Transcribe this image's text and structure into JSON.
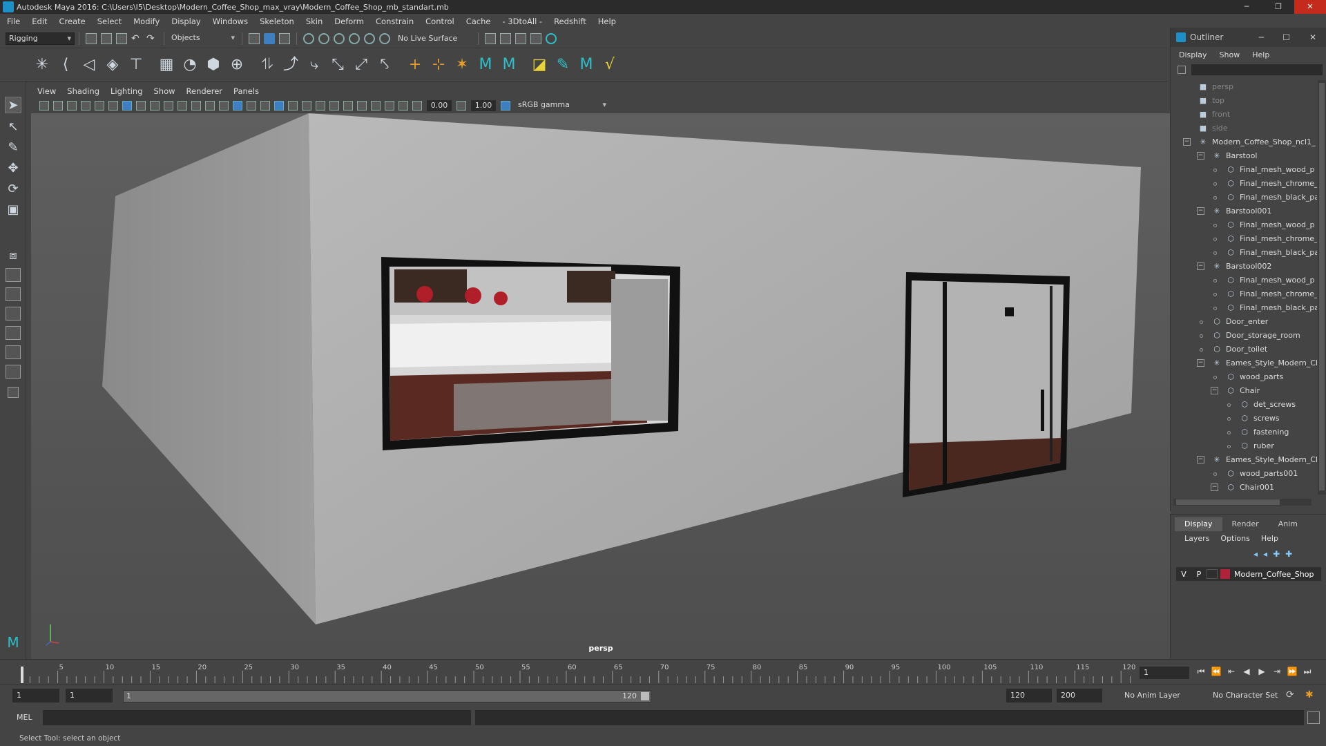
{
  "window": {
    "title": "Autodesk Maya 2016: C:\\Users\\I5\\Desktop\\Modern_Coffee_Shop_max_vray\\Modern_Coffee_Shop_mb_standart.mb"
  },
  "menus": [
    "File",
    "Edit",
    "Create",
    "Select",
    "Modify",
    "Display",
    "Windows",
    "Skeleton",
    "Skin",
    "Deform",
    "Constrain",
    "Control",
    "Cache",
    "- 3DtoAll -",
    "Redshift",
    "Help"
  ],
  "status_line": {
    "mode": "Rigging",
    "selection_mode": "Objects",
    "live_surface": "No Live Surface"
  },
  "panel_menu": [
    "View",
    "Shading",
    "Lighting",
    "Show",
    "Renderer",
    "Panels"
  ],
  "panel_toolbar": {
    "near_value": "0.00",
    "far_value": "1.00",
    "color_space": "sRGB gamma"
  },
  "viewport": {
    "camera_label": "persp"
  },
  "outliner": {
    "title": "Outliner",
    "menu": [
      "Display",
      "Show",
      "Help"
    ],
    "items": [
      {
        "label": "persp",
        "indent": 0,
        "type": "camera",
        "dim": true
      },
      {
        "label": "top",
        "indent": 0,
        "type": "camera",
        "dim": true
      },
      {
        "label": "front",
        "indent": 0,
        "type": "camera",
        "dim": true
      },
      {
        "label": "side",
        "indent": 0,
        "type": "camera",
        "dim": true
      },
      {
        "label": "Modern_Coffee_Shop_ncl1_",
        "indent": 0,
        "type": "group",
        "expand": true
      },
      {
        "label": "Barstool",
        "indent": 1,
        "type": "group",
        "expand": true
      },
      {
        "label": "Final_mesh_wood_p",
        "indent": 2,
        "type": "mesh"
      },
      {
        "label": "Final_mesh_chrome_",
        "indent": 2,
        "type": "mesh"
      },
      {
        "label": "Final_mesh_black_pa",
        "indent": 2,
        "type": "mesh"
      },
      {
        "label": "Barstool001",
        "indent": 1,
        "type": "group",
        "expand": true
      },
      {
        "label": "Final_mesh_wood_p",
        "indent": 2,
        "type": "mesh"
      },
      {
        "label": "Final_mesh_chrome_",
        "indent": 2,
        "type": "mesh"
      },
      {
        "label": "Final_mesh_black_pa",
        "indent": 2,
        "type": "mesh"
      },
      {
        "label": "Barstool002",
        "indent": 1,
        "type": "group",
        "expand": true
      },
      {
        "label": "Final_mesh_wood_p",
        "indent": 2,
        "type": "mesh"
      },
      {
        "label": "Final_mesh_chrome_",
        "indent": 2,
        "type": "mesh"
      },
      {
        "label": "Final_mesh_black_pa",
        "indent": 2,
        "type": "mesh"
      },
      {
        "label": "Door_enter",
        "indent": 1,
        "type": "mesh"
      },
      {
        "label": "Door_storage_room",
        "indent": 1,
        "type": "mesh"
      },
      {
        "label": "Door_toilet",
        "indent": 1,
        "type": "mesh"
      },
      {
        "label": "Eames_Style_Modern_Ch",
        "indent": 1,
        "type": "group",
        "expand": true
      },
      {
        "label": "wood_parts",
        "indent": 2,
        "type": "mesh"
      },
      {
        "label": "Chair",
        "indent": 2,
        "type": "mesh",
        "expand": true
      },
      {
        "label": "det_screws",
        "indent": 3,
        "type": "mesh"
      },
      {
        "label": "screws",
        "indent": 3,
        "type": "mesh"
      },
      {
        "label": "fastening",
        "indent": 3,
        "type": "mesh"
      },
      {
        "label": "ruber",
        "indent": 3,
        "type": "mesh"
      },
      {
        "label": "Eames_Style_Modern_Ch",
        "indent": 1,
        "type": "group",
        "expand": true
      },
      {
        "label": "wood_parts001",
        "indent": 2,
        "type": "mesh"
      },
      {
        "label": "Chair001",
        "indent": 2,
        "type": "mesh",
        "expand": true
      }
    ]
  },
  "layer_editor": {
    "tabs": [
      "Display",
      "Render",
      "Anim"
    ],
    "menu": [
      "Layers",
      "Options",
      "Help"
    ],
    "layer": {
      "v": "V",
      "p": "P",
      "name": "Modern_Coffee_Shop",
      "color": "#b0213a"
    }
  },
  "time_slider": {
    "ticks": [
      5,
      10,
      15,
      20,
      25,
      30,
      35,
      40,
      45,
      50,
      55,
      60,
      65,
      70,
      75,
      80,
      85,
      90,
      95,
      100,
      105,
      110,
      115,
      120
    ],
    "start_marker": "1",
    "current_frame": "1"
  },
  "range_slider": {
    "start": "1",
    "playback_start": "1",
    "range_start_label": "1",
    "range_end_label": "120",
    "playback_end": "120",
    "end": "200",
    "anim_layer": "No Anim Layer",
    "character_set": "No Character Set"
  },
  "command_line": {
    "label": "MEL"
  },
  "help_line": {
    "text": "Select Tool: select an object"
  }
}
